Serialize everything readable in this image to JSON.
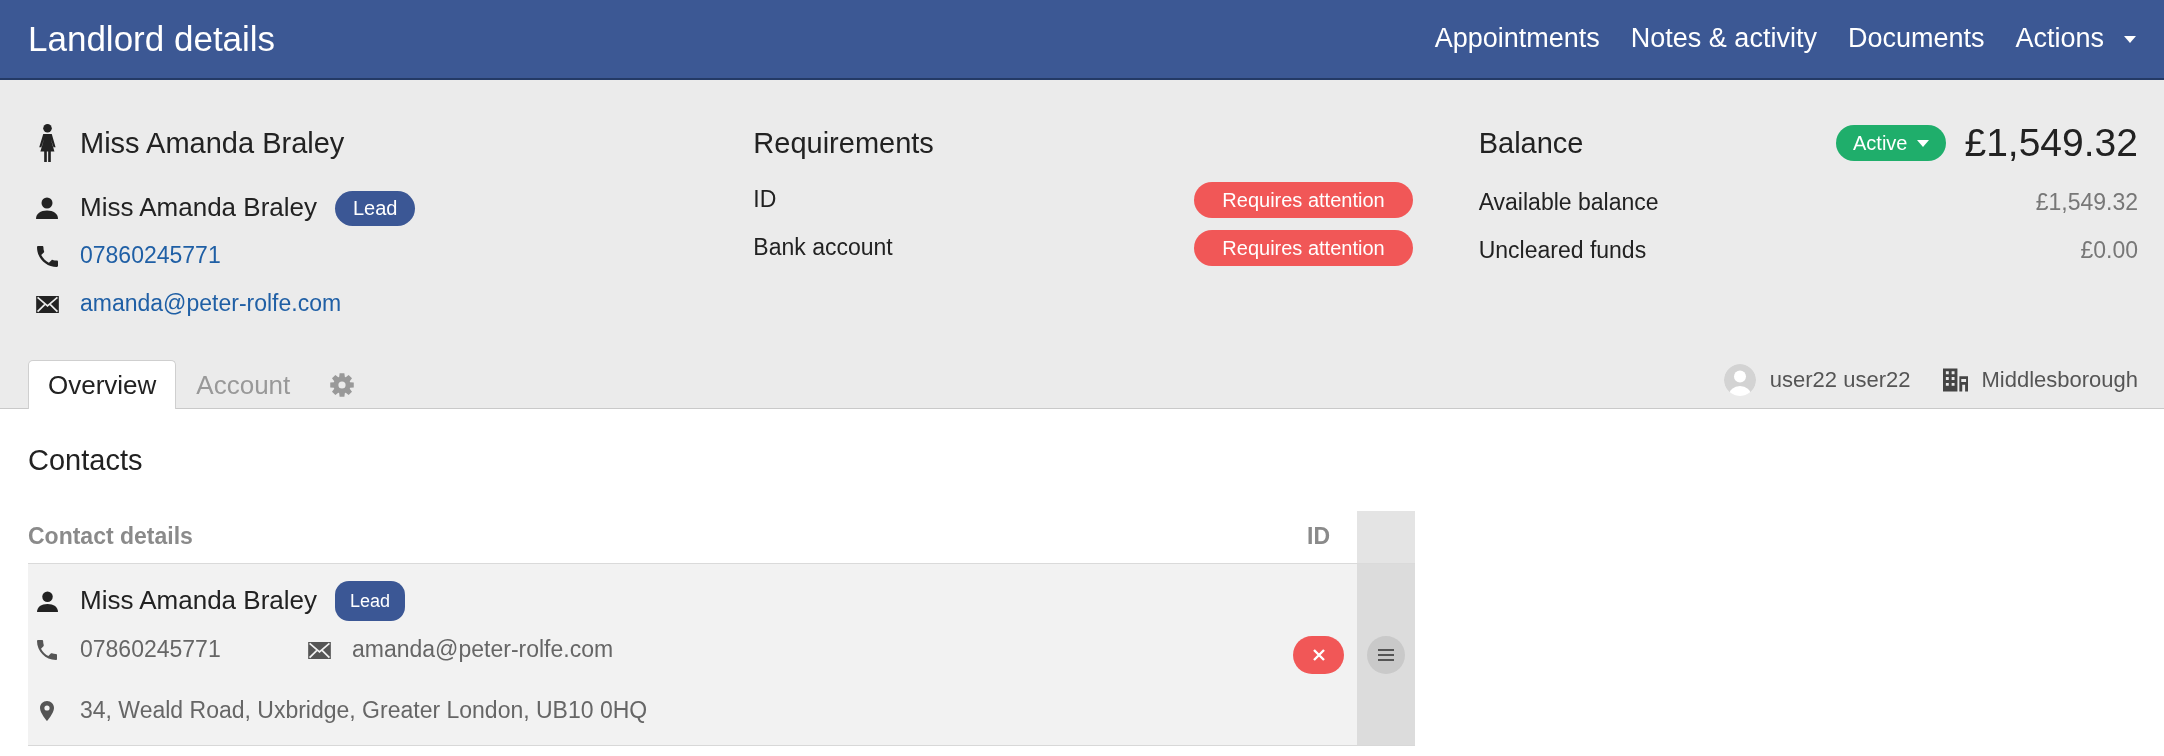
{
  "header": {
    "title": "Landlord details",
    "nav": [
      {
        "label": "Appointments",
        "kind": "link"
      },
      {
        "label": "Notes & activity",
        "kind": "link"
      },
      {
        "label": "Documents",
        "kind": "link"
      },
      {
        "label": "Actions",
        "kind": "dropdown"
      }
    ]
  },
  "landlord": {
    "name": "Miss Amanda Braley",
    "contact_name": "Miss Amanda Braley",
    "badge": "Lead",
    "phone": "07860245771",
    "email": "amanda@peter-rolfe.com"
  },
  "requirements": {
    "title": "Requirements",
    "items": [
      {
        "label": "ID",
        "status": "Requires attention"
      },
      {
        "label": "Bank account",
        "status": "Requires attention"
      }
    ]
  },
  "balance": {
    "title": "Balance",
    "status": "Active",
    "amount": "£1,549.32",
    "rows": [
      {
        "label": "Available balance",
        "value": "£1,549.32"
      },
      {
        "label": "Uncleared funds",
        "value": "£0.00"
      }
    ]
  },
  "tabs": [
    {
      "kind": "text",
      "label": "Overview",
      "selected": true
    },
    {
      "kind": "text",
      "label": "Account",
      "selected": false
    },
    {
      "kind": "settings",
      "selected": false
    }
  ],
  "assignment": {
    "user": "user22 user22",
    "branch": "Middlesborough"
  },
  "contacts": {
    "title": "Contacts",
    "columns": [
      "Contact details",
      "ID"
    ],
    "rows": [
      {
        "name": "Miss Amanda Braley",
        "badge": "Lead",
        "phone": "07860245771",
        "email": "amanda@peter-rolfe.com",
        "address": "34, Weald Road, Uxbridge, Greater London, UB10 0HQ",
        "id_verified": false
      }
    ]
  }
}
